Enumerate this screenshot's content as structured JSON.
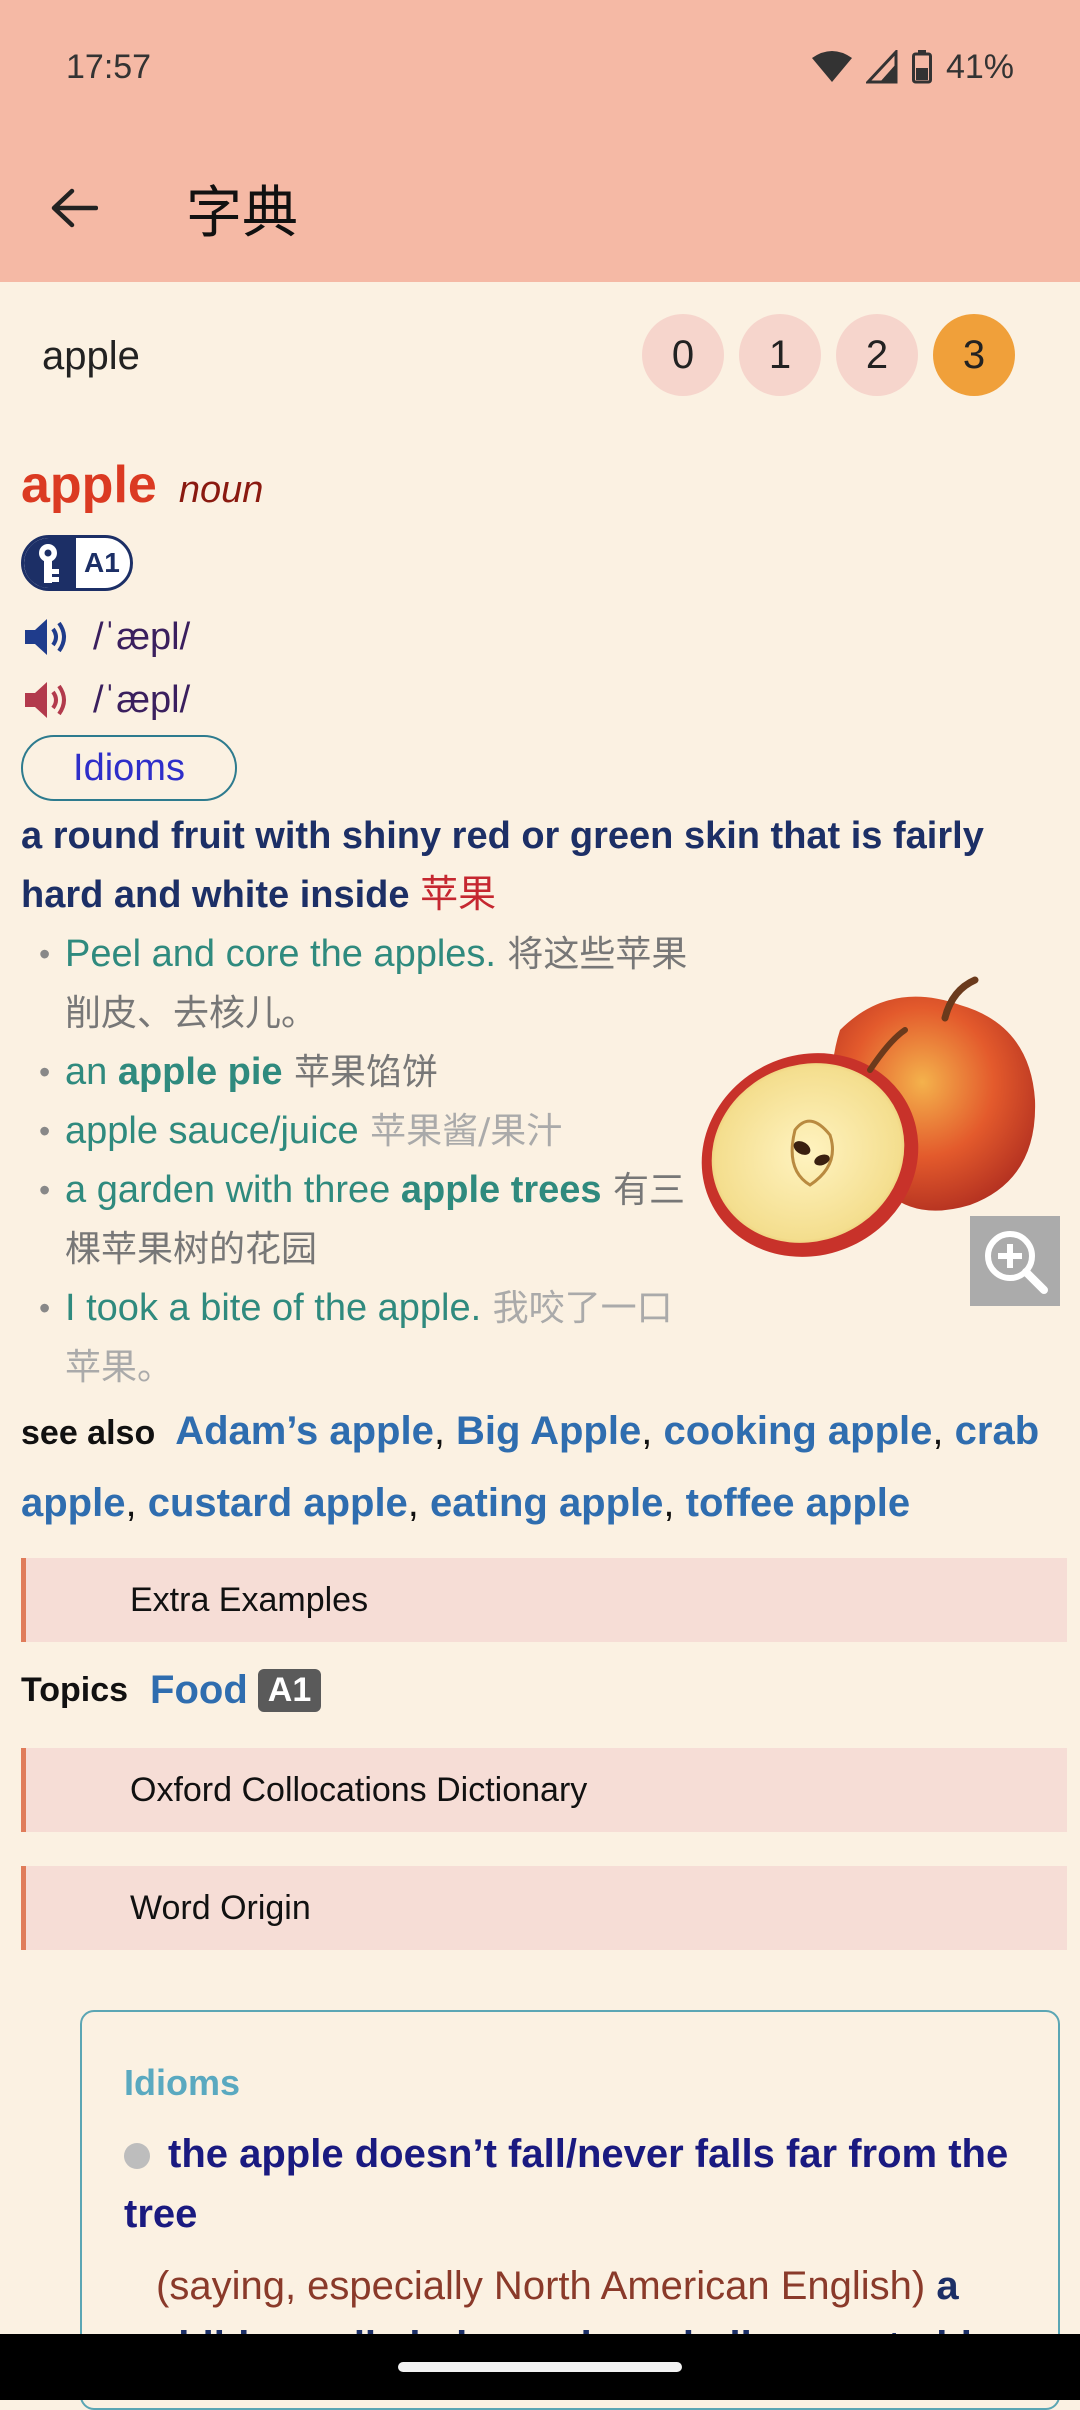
{
  "status": {
    "time": "17:57",
    "battery": "41%"
  },
  "app_bar": {
    "title": "字典"
  },
  "search": {
    "value": "apple",
    "placeholder": ""
  },
  "levels": [
    {
      "label": "0"
    },
    {
      "label": "1"
    },
    {
      "label": "2"
    },
    {
      "label": "3",
      "selected": true
    }
  ],
  "entry": {
    "headword": "apple",
    "pos": "noun",
    "level_badge": "A1",
    "pron_uk": "/ˈæpl/",
    "pron_us": "/ˈæpl/",
    "idioms_button": "Idioms",
    "definition": "a round fruit with shiny red or green skin that is fairly hard and white inside",
    "definition_zh": "苹果",
    "examples": [
      {
        "parts": [
          {
            "t": "Peel and core the apples."
          },
          {
            "t": " 将这些苹果削皮、去核儿。",
            "zh": "gray"
          }
        ]
      },
      {
        "parts": [
          {
            "t": "an "
          },
          {
            "t": "apple pie",
            "b": true
          },
          {
            "t": " 苹果馅饼",
            "zh": "gray"
          }
        ]
      },
      {
        "parts": [
          {
            "t": "apple sauce/juice"
          },
          {
            "t": " 苹果酱/果汁",
            "zh": "light"
          }
        ]
      },
      {
        "parts": [
          {
            "t": "a garden with three "
          },
          {
            "t": "apple trees",
            "b": true
          },
          {
            "t": " 有三棵苹果树的花园",
            "zh": "gray"
          }
        ]
      },
      {
        "parts": [
          {
            "t": "I took a bite of the apple."
          },
          {
            "t": " 我咬了一口苹果。",
            "zh": "light"
          }
        ]
      }
    ],
    "see_also_label": "see also",
    "see_also": [
      "Adam’s apple",
      "Big Apple",
      "cooking apple",
      "crab apple",
      "custard apple",
      "eating apple",
      "toffee apple"
    ]
  },
  "sections": {
    "extra_examples": "Extra Examples",
    "collocations": "Oxford Collocations Dictionary",
    "word_origin": "Word Origin"
  },
  "topics": {
    "label": "Topics",
    "topic": "Food",
    "level": "A1"
  },
  "idioms_box": {
    "heading": "Idioms",
    "phrase": "the apple doesn’t fall/never falls far from the tree",
    "label": "(saying, especially North American English)",
    "meaning": "a child usually behaves in a similar way to his"
  },
  "colors": {
    "accent": "#F5B9A5",
    "background": "#FBF1E2",
    "headword": "#DB3A22",
    "link": "#2F6DAF",
    "selected_level": "#F0A03A"
  }
}
